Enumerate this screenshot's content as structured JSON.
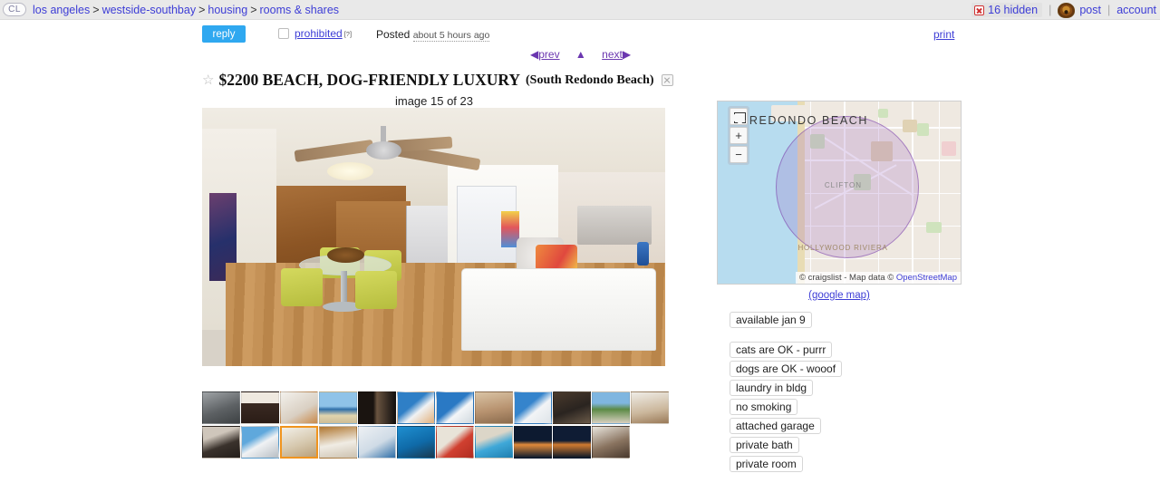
{
  "header": {
    "logo_text": "CL",
    "breadcrumb": [
      {
        "label": "los angeles",
        "sep": ">"
      },
      {
        "label": "westside-southbay",
        "sep": ">"
      },
      {
        "label": "housing",
        "sep": ">"
      },
      {
        "label": "rooms & shares",
        "sep": ""
      }
    ],
    "hidden_count_label": "16 hidden",
    "post_label": "post",
    "account_label": "account"
  },
  "actionbar": {
    "reply_label": "reply",
    "prohibited_label": "prohibited",
    "prohibited_sup": "[?]",
    "posted_label": "Posted",
    "posted_ago": "about 5 hours ago",
    "print_label": "print"
  },
  "nav": {
    "prev_label": "prev",
    "prev_arrow": "◀",
    "up_arrow": "▲",
    "next_label": "next",
    "next_arrow": "▶"
  },
  "listing": {
    "star_glyph": "☆",
    "price_title": "$2200 BEACH, DOG-FRIENDLY LUXURY",
    "neighborhood": "(South Redondo Beach)",
    "image_counter": "image 15 of 23",
    "current_image_index": 15,
    "total_images": 23
  },
  "map": {
    "city_label": "REDONDO BEACH",
    "clifton_label": "CLIFTON",
    "hollywood_label": "HOLLYWOOD RIVIERA",
    "fullscreen_label": "",
    "zoom_in_label": "+",
    "zoom_out_label": "−",
    "attribution_prefix": "© craigslist - Map data © ",
    "attribution_link": "OpenStreetMap",
    "google_map_link": "(google map)"
  },
  "attributes": {
    "availability": [
      "available jan 9"
    ],
    "features": [
      "cats are OK - purrr",
      "dogs are OK - wooof",
      "laundry in bldg",
      "no smoking",
      "attached garage",
      "private bath",
      "private room"
    ]
  },
  "colors": {
    "reply_button": "#2fa8f0",
    "link": "#3d3dd6",
    "visited_link": "#6b37b0",
    "selected_thumb_border": "#f0941e",
    "header_bg": "#e9e9e9"
  },
  "thumbnails": {
    "row1_count": 12,
    "row2_count": 11,
    "selected_row": 2,
    "selected_index": 3
  }
}
